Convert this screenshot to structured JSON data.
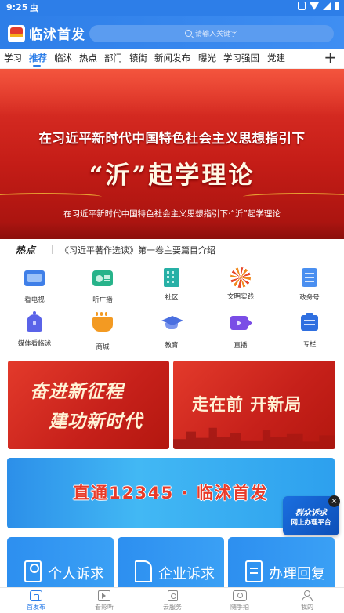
{
  "status": {
    "time": "9:25",
    "app_glyph": "虫"
  },
  "header": {
    "title": "临沭首发",
    "search_placeholder": "请输入关键字"
  },
  "tabs": [
    {
      "label": "学习"
    },
    {
      "label": "推荐"
    },
    {
      "label": "临沭"
    },
    {
      "label": "热点"
    },
    {
      "label": "部门"
    },
    {
      "label": "镇街"
    },
    {
      "label": "新闻发布"
    },
    {
      "label": "曝光"
    },
    {
      "label": "学习强国"
    },
    {
      "label": "党建"
    }
  ],
  "tab_add": "+",
  "banner": {
    "headline_line1": "在习近平新时代中国特色社会主义思想指引下",
    "headline_line2": "“沂”起学理论",
    "caption": "在习近平新时代中国特色社会主义思想指引下·“沂”起学理论"
  },
  "hot": {
    "label": "热点",
    "text": "《习近平著作选读》第一卷主要篇目介绍"
  },
  "grid": [
    {
      "label": "看电视",
      "icon": "tv-icon"
    },
    {
      "label": "听广播",
      "icon": "radio-icon"
    },
    {
      "label": "社区",
      "icon": "building-icon"
    },
    {
      "label": "文明实践",
      "icon": "flower-icon"
    },
    {
      "label": "政务号",
      "icon": "document-icon"
    },
    {
      "label": "媒体看临沭",
      "icon": "bell-icon"
    },
    {
      "label": "商城",
      "icon": "cup-icon"
    },
    {
      "label": "教育",
      "icon": "graduation-cap-icon"
    },
    {
      "label": "直播",
      "icon": "video-icon"
    },
    {
      "label": "专栏",
      "icon": "column-icon"
    }
  ],
  "promos": {
    "left_line1": "奋进新征程",
    "left_line2": "建功新时代",
    "right": "走在前 开新局"
  },
  "hotline": {
    "text": "直通12345 · 临沭首发"
  },
  "float_badge": {
    "line1": "群众诉求",
    "line2": "网上办理平台",
    "close": "×"
  },
  "services": [
    {
      "label": "个人诉求",
      "icon": "person-icon"
    },
    {
      "label": "企业诉求",
      "icon": "building-icon"
    },
    {
      "label": "办理回复",
      "icon": "reply-document-icon"
    }
  ],
  "bottom_nav": [
    {
      "label": "首发布",
      "icon": "home-icon"
    },
    {
      "label": "看影听",
      "icon": "film-icon"
    },
    {
      "label": "云服务",
      "icon": "service-icon"
    },
    {
      "label": "随手拍",
      "icon": "camera-icon"
    },
    {
      "label": "我的",
      "icon": "profile-icon"
    }
  ],
  "colors": {
    "brand_blue": "#2d7ee8",
    "banner_red": "#c51d17",
    "hotline_text": "#e83b2a"
  }
}
